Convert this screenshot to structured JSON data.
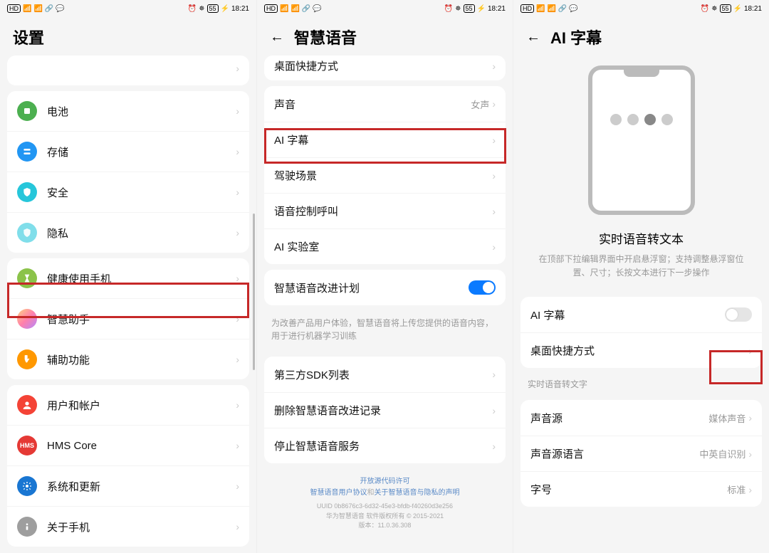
{
  "status": {
    "time": "18:21",
    "battery": "55",
    "hd": "HD"
  },
  "s1": {
    "title": "设置",
    "rows": [
      {
        "id": "battery",
        "label": "电池",
        "iconClass": "i-green"
      },
      {
        "id": "storage",
        "label": "存储",
        "iconClass": "i-blue"
      },
      {
        "id": "security",
        "label": "安全",
        "iconClass": "i-teal"
      },
      {
        "id": "privacy",
        "label": "隐私",
        "iconClass": "i-lteal"
      }
    ],
    "rows2": [
      {
        "id": "health",
        "label": "健康使用手机",
        "iconClass": "i-sand"
      },
      {
        "id": "smartassist",
        "label": "智慧助手",
        "iconClass": "i-grad"
      },
      {
        "id": "accessibility",
        "label": "辅助功能",
        "iconClass": "i-orange"
      }
    ],
    "rows3": [
      {
        "id": "users",
        "label": "用户和帐户",
        "iconClass": "i-red"
      },
      {
        "id": "hms",
        "label": "HMS Core",
        "iconClass": "i-hms",
        "text": "HMS"
      },
      {
        "id": "sysupdate",
        "label": "系统和更新",
        "iconClass": "i-nav"
      },
      {
        "id": "about",
        "label": "关于手机",
        "iconClass": "i-gray"
      }
    ]
  },
  "s2": {
    "title": "智慧语音",
    "shortcut": "桌面快捷方式",
    "rowsA": [
      {
        "id": "voice",
        "label": "声音",
        "value": "女声"
      },
      {
        "id": "ai-subtitle",
        "label": "AI 字幕"
      },
      {
        "id": "driving",
        "label": "驾驶场景"
      },
      {
        "id": "voice-call",
        "label": "语音控制呼叫"
      },
      {
        "id": "ai-lab",
        "label": "AI 实验室"
      }
    ],
    "plan": {
      "label": "智慧语音改进计划",
      "desc": "为改善产品用户体验，智慧语音将上传您提供的语音内容，用于进行机器学习训练"
    },
    "rowsB": [
      {
        "id": "sdk",
        "label": "第三方SDK列表"
      },
      {
        "id": "del-records",
        "label": "删除智慧语音改进记录"
      },
      {
        "id": "stop-service",
        "label": "停止智慧语音服务"
      }
    ],
    "footer": {
      "l1": "开放源代码许可",
      "l2a": "智慧语音用户协议",
      "l2b": "和",
      "l2c": "关于智慧语音与隐私的声明",
      "uuid": "UUID 0b8676c3-6d32-45e3-bfdb-f40260d3e256",
      "copy": "华为智慧语音 软件版权所有 © 2015-2021",
      "ver": "版本：11.0.36.308"
    }
  },
  "s3": {
    "title": "AI 字幕",
    "promoTitle": "实时语音转文本",
    "promoDesc": "在顶部下拉编辑界面中开启悬浮窗；支持调整悬浮窗位置、尺寸；长按文本进行下一步操作",
    "rowsA": [
      {
        "id": "ai-subtitle-toggle",
        "label": "AI 字幕"
      },
      {
        "id": "shortcut",
        "label": "桌面快捷方式"
      }
    ],
    "sectionA": "实时语音转文字",
    "rowsB": [
      {
        "id": "audio-src",
        "label": "声音源",
        "value": "媒体声音"
      },
      {
        "id": "audio-lang",
        "label": "声音源语言",
        "value": "中英自识别"
      },
      {
        "id": "font-size",
        "label": "字号",
        "value": "标准"
      }
    ]
  }
}
